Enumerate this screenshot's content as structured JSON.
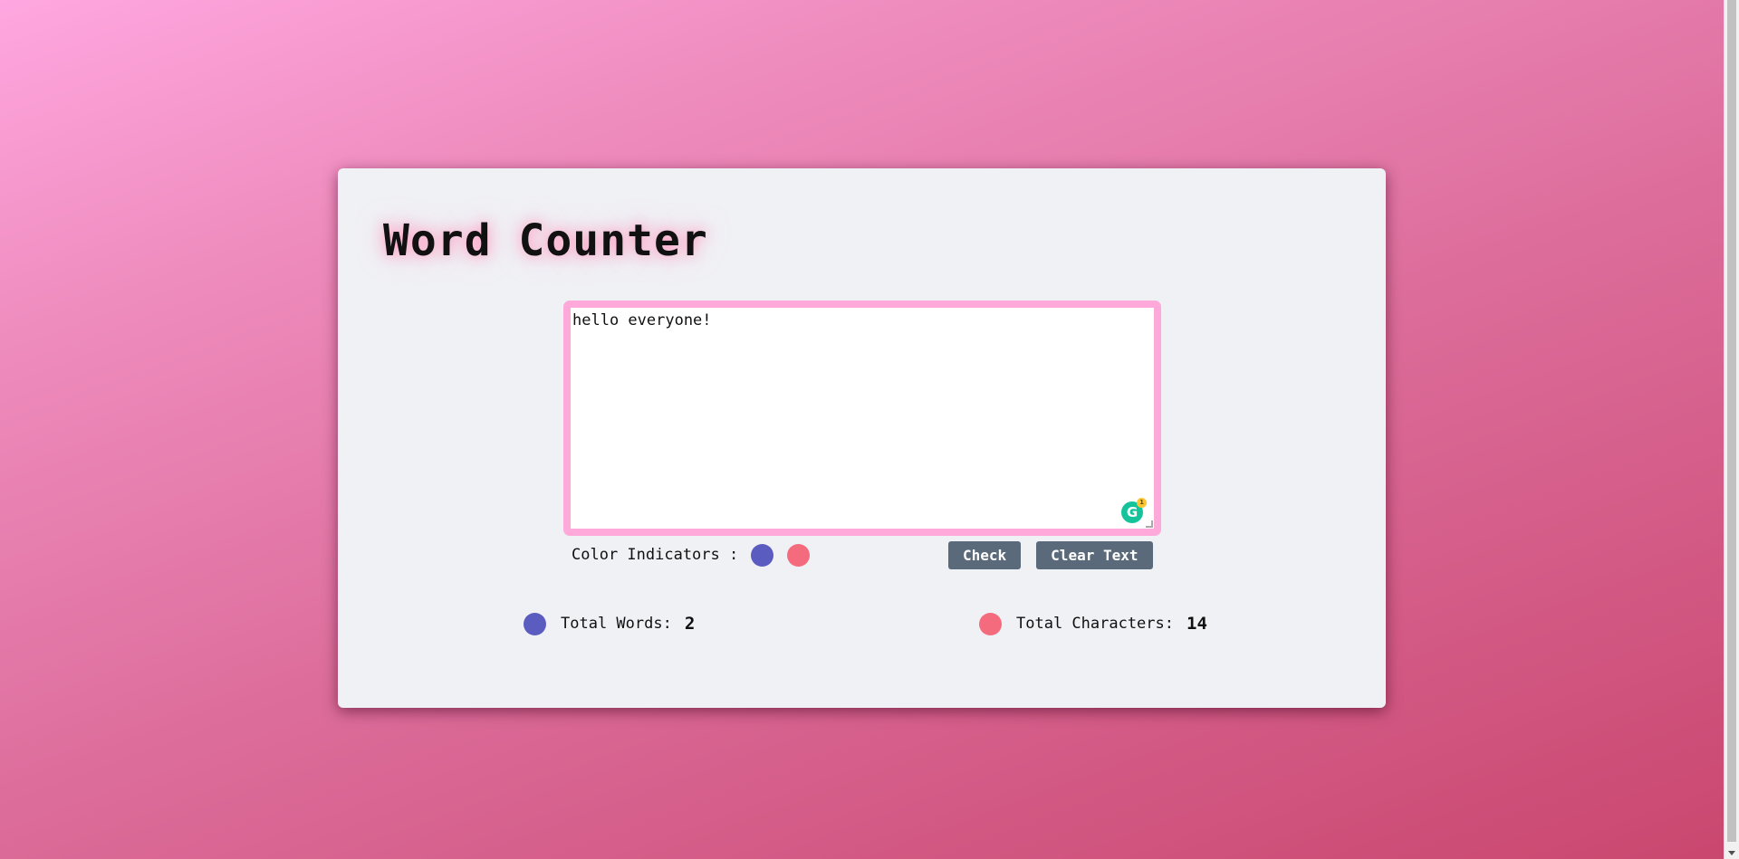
{
  "app": {
    "title": "Word Counter"
  },
  "editor": {
    "value": "hello everyone!",
    "grammarly_count": "1",
    "grammarly_letter": "G"
  },
  "indicators": {
    "label": "Color Indicators :",
    "words_color": "#5a5cbf",
    "chars_color": "#f46b7e"
  },
  "buttons": {
    "check_label": "Check",
    "clear_label": "Clear Text"
  },
  "stats": {
    "words_label": "Total Words:",
    "words_value": "2",
    "chars_label": "Total Characters:",
    "chars_value": "14"
  },
  "colors": {
    "button_bg": "#5a6a7a",
    "textarea_border": "#ffa9db",
    "card_bg": "#f0f1f5"
  },
  "icons": {
    "grammarly": "grammarly-icon",
    "resize": "resize-grip-icon"
  }
}
